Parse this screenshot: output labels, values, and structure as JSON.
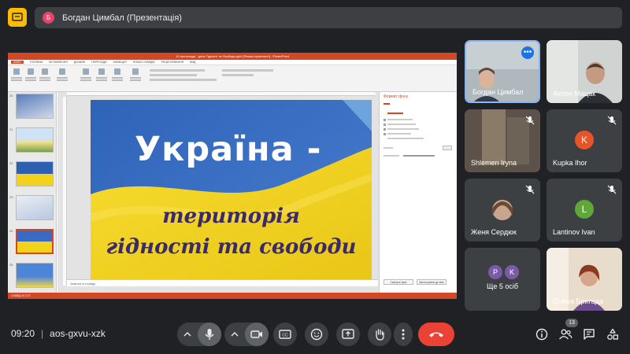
{
  "top": {
    "presenter_initial": "Б",
    "presenter_label": "Богдан Цимбал (Презентація)"
  },
  "ppt": {
    "title_bar": "10 листопада - день Гідності та Свободи.pptx [Режим сумісності] - PowerPoint",
    "tabs": [
      "ФАЙЛ",
      "ГОЛОВНА",
      "ВСТАВЛЕННЯ",
      "ДИЗАЙН",
      "ПЕРЕХОДИ",
      "АНІМАЦІЯ",
      "ПОКАЗ СЛАЙДІВ",
      "РЕЦЕНЗУВАННЯ",
      "ВИД"
    ],
    "thumb_numbers": [
      "20",
      "21",
      "22",
      "23",
      "24",
      "25",
      "26"
    ],
    "slide": {
      "title": "Україна -",
      "line2": "територія",
      "line3": "гідності та свободи"
    },
    "notes_placeholder": "Замітки зі слайду",
    "format_pane_title": "Формат фону",
    "format_buttons": [
      "Скинути фон",
      "Застосувати до всіх"
    ],
    "status": "СЛАЙД 24 З 27"
  },
  "participants": [
    {
      "name": "Богдан Цимбал"
    },
    {
      "name": "Антон Мацак"
    },
    {
      "name": "Shlemen Iryna"
    },
    {
      "name": "Kupka Ihor",
      "initial": "K",
      "color": "#e8542a"
    },
    {
      "name": "Женя Сердюк"
    },
    {
      "name": "Lantinov Ivan",
      "initial": "L",
      "color": "#5ea83a"
    },
    {
      "name": "Ще 5 осіб",
      "initials": [
        "P",
        "K"
      ],
      "colors": [
        "#7b5ba8",
        "#7b5ba8"
      ]
    },
    {
      "name": "Олена Бригада"
    }
  ],
  "bottom": {
    "time": "09:20",
    "meeting_code": "aos-gxvu-xzk",
    "participant_count": "13"
  },
  "colors": {
    "background": "#202124",
    "tile": "#3c4043",
    "end_call": "#ea4335",
    "accent": "#1a73e8",
    "ppt_orange": "#d24726",
    "flag_blue": "#3a6bc4",
    "flag_yellow": "#f3d21b"
  }
}
